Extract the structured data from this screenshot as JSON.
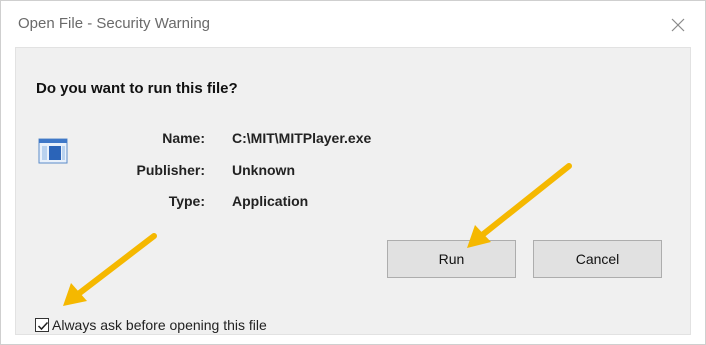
{
  "window": {
    "title": "Open File - Security Warning"
  },
  "dialog": {
    "question": "Do you want to run this file?",
    "fields": [
      {
        "label": "Name:",
        "value": "C:\\MIT\\MITPlayer.exe"
      },
      {
        "label": "Publisher:",
        "value": "Unknown"
      },
      {
        "label": "Type:",
        "value": "Application"
      }
    ],
    "buttons": {
      "run": "Run",
      "cancel": "Cancel"
    },
    "checkbox": {
      "label": "Always ask before opening this file",
      "checked": true
    }
  },
  "icons": {
    "close": "close-icon",
    "file": "application-file-icon",
    "annotation_arrows": "arrow-icon"
  },
  "colors": {
    "arrow": "#f5b800",
    "panel": "#f0f0f0",
    "button": "#e1e1e1"
  }
}
